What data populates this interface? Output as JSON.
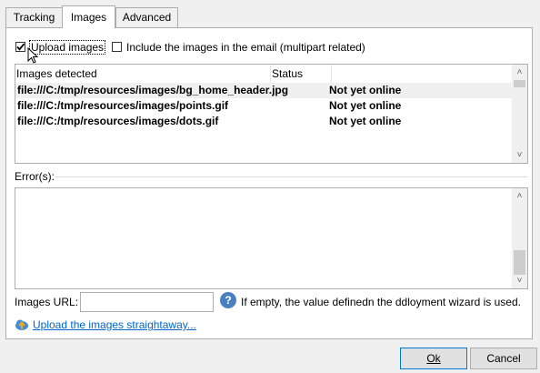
{
  "tabs": [
    {
      "label": "Tracking",
      "active": false
    },
    {
      "label": "Images",
      "active": true
    },
    {
      "label": "Advanced",
      "active": false
    }
  ],
  "options": {
    "upload_images": {
      "label": "Upload images",
      "checked": true
    },
    "include_images": {
      "label": "Include the images in the email (multipart related)",
      "checked": false
    }
  },
  "images_list": {
    "columns": [
      "Images detected",
      "Status"
    ],
    "rows": [
      {
        "path": "file:///C:/tmp/resources/images/bg_home_header.jpg",
        "status": "Not yet online"
      },
      {
        "path": "file:///C:/tmp/resources/images/points.gif",
        "status": "Not yet online"
      },
      {
        "path": "file:///C:/tmp/resources/images/dots.gif",
        "status": "Not yet online"
      }
    ]
  },
  "errors": {
    "label": "Error(s):"
  },
  "images_url": {
    "label": "Images URL:",
    "value": "",
    "help_text": "If empty, the value definedn the ddloyment wizard is used."
  },
  "upload_link": "Upload the images straightaway...",
  "buttons": {
    "ok": "Ok",
    "cancel": "Cancel"
  },
  "colors": {
    "link": "#0066cc",
    "help_icon": "#4a7fc1",
    "default_button_border": "#0078d7"
  }
}
